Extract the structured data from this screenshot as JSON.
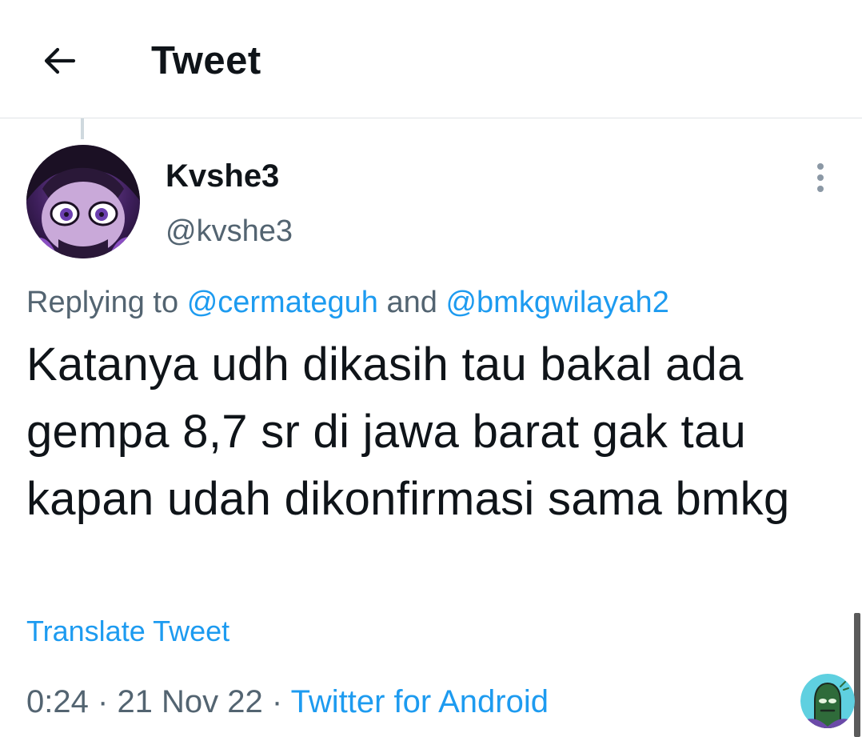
{
  "header": {
    "title": "Tweet"
  },
  "tweet": {
    "display_name": "Kvshe3",
    "handle": "@kvshe3",
    "replying_prefix": "Replying to",
    "replying_mentions": [
      "@cermateguh",
      "@bmkgwilayah2"
    ],
    "replying_joiner": "and",
    "text": "Katanya udh dikasih tau bakal ada gempa 8,7 sr di jawa barat gak tau kapan udah dikonfirmasi sama bmkg",
    "translate_label": "Translate Tweet",
    "time": "0:24",
    "date": "21 Nov 22",
    "source": "Twitter for Android",
    "separator": "·"
  },
  "colors": {
    "accent": "#1d9bf0",
    "secondary_text": "#536471",
    "primary_text": "#0f1419",
    "divider": "#dfe3e6"
  },
  "icons": {
    "back": "arrow-left-icon",
    "more": "more-vertical-icon"
  }
}
